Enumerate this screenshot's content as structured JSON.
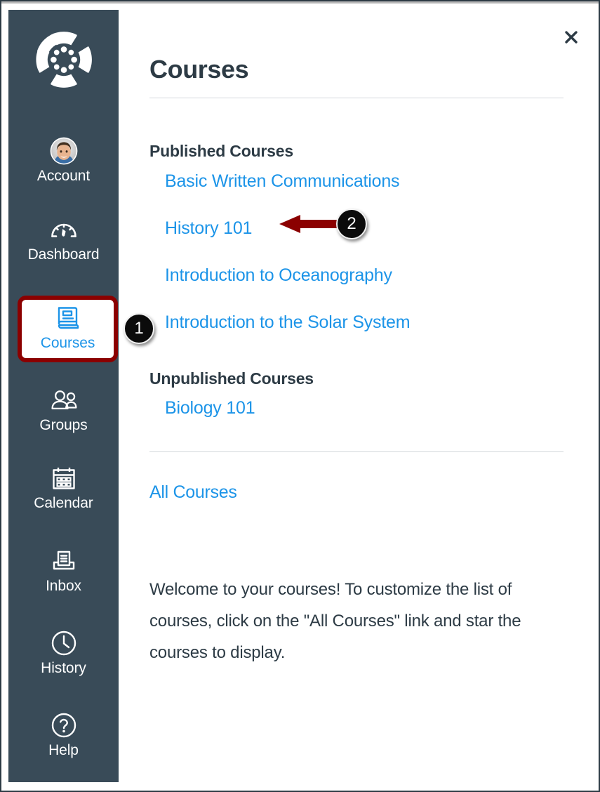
{
  "app": {
    "logo": "canvas-logo"
  },
  "sidebar": {
    "items": [
      {
        "id": "account",
        "label": "Account",
        "icon": "avatar-icon",
        "active": false
      },
      {
        "id": "dashboard",
        "label": "Dashboard",
        "icon": "gauge-icon",
        "active": false
      },
      {
        "id": "courses",
        "label": "Courses",
        "icon": "book-icon",
        "active": true
      },
      {
        "id": "groups",
        "label": "Groups",
        "icon": "people-icon",
        "active": false
      },
      {
        "id": "calendar",
        "label": "Calendar",
        "icon": "calendar-icon",
        "active": false
      },
      {
        "id": "inbox",
        "label": "Inbox",
        "icon": "inbox-tray-icon",
        "active": false
      },
      {
        "id": "history",
        "label": "History",
        "icon": "clock-icon",
        "active": false
      },
      {
        "id": "help",
        "label": "Help",
        "icon": "question-mark-icon",
        "active": false
      }
    ]
  },
  "tray": {
    "title": "Courses",
    "close_label": "×",
    "groups": [
      {
        "heading": "Published Courses",
        "courses": [
          "Basic Written Communications",
          "History 101",
          "Introduction to Oceanography",
          "Introduction to the Solar System"
        ]
      },
      {
        "heading": "Unpublished Courses",
        "courses": [
          "Biology 101"
        ]
      }
    ],
    "all_courses_label": "All Courses",
    "welcome_text": "Welcome to your courses! To customize the list of courses, click on the \"All Courses\" link and star the courses to display."
  },
  "annotations": [
    {
      "number": "1",
      "target": "courses-nav-item"
    },
    {
      "number": "2",
      "target": "history-101-link"
    }
  ],
  "colors": {
    "sidebar_bg": "#394B58",
    "link_blue": "#1C94E8",
    "text_dark": "#2D3B45",
    "annotation_red": "#8B0000",
    "badge_black": "#0B0B0B"
  }
}
